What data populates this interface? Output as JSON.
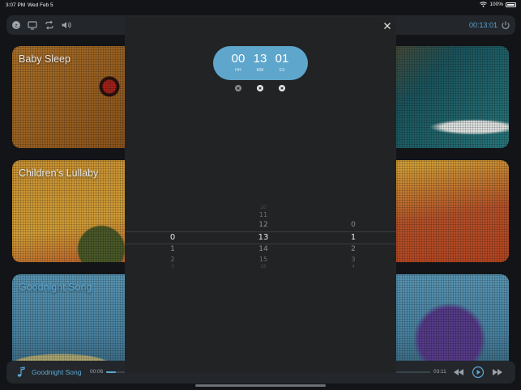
{
  "status_bar": {
    "time": "3:07 PM",
    "date": "Wed Feb 5",
    "battery": "100%"
  },
  "top_bar": {
    "elapsed": "00:13:01"
  },
  "cards": [
    {
      "title": "Baby Sleep"
    },
    {
      "title": "Children's Lullaby"
    },
    {
      "title": "Goodnight Song"
    }
  ],
  "player": {
    "song": "Goodnight Song",
    "current_time": "00:06",
    "total_time": "03:11",
    "progress": 0.03
  },
  "timer": {
    "hours": "00",
    "minutes": "13",
    "seconds": "01",
    "hours_label": "HH",
    "minutes_label": "MM",
    "seconds_label": "SS"
  },
  "picker": {
    "hours_above": [],
    "hours_selected": "0",
    "hours_below": [
      "1",
      "2",
      "3"
    ],
    "minutes_above": [
      "10",
      "11",
      "12"
    ],
    "minutes_selected": "13",
    "minutes_below": [
      "14",
      "15",
      "16"
    ],
    "seconds_above": [
      "0"
    ],
    "seconds_selected": "1",
    "seconds_below": [
      "2",
      "3",
      "4"
    ]
  },
  "colors": {
    "accent": "#5ea6cc",
    "modal_bg": "#212325",
    "bar_bg": "#23272c"
  }
}
